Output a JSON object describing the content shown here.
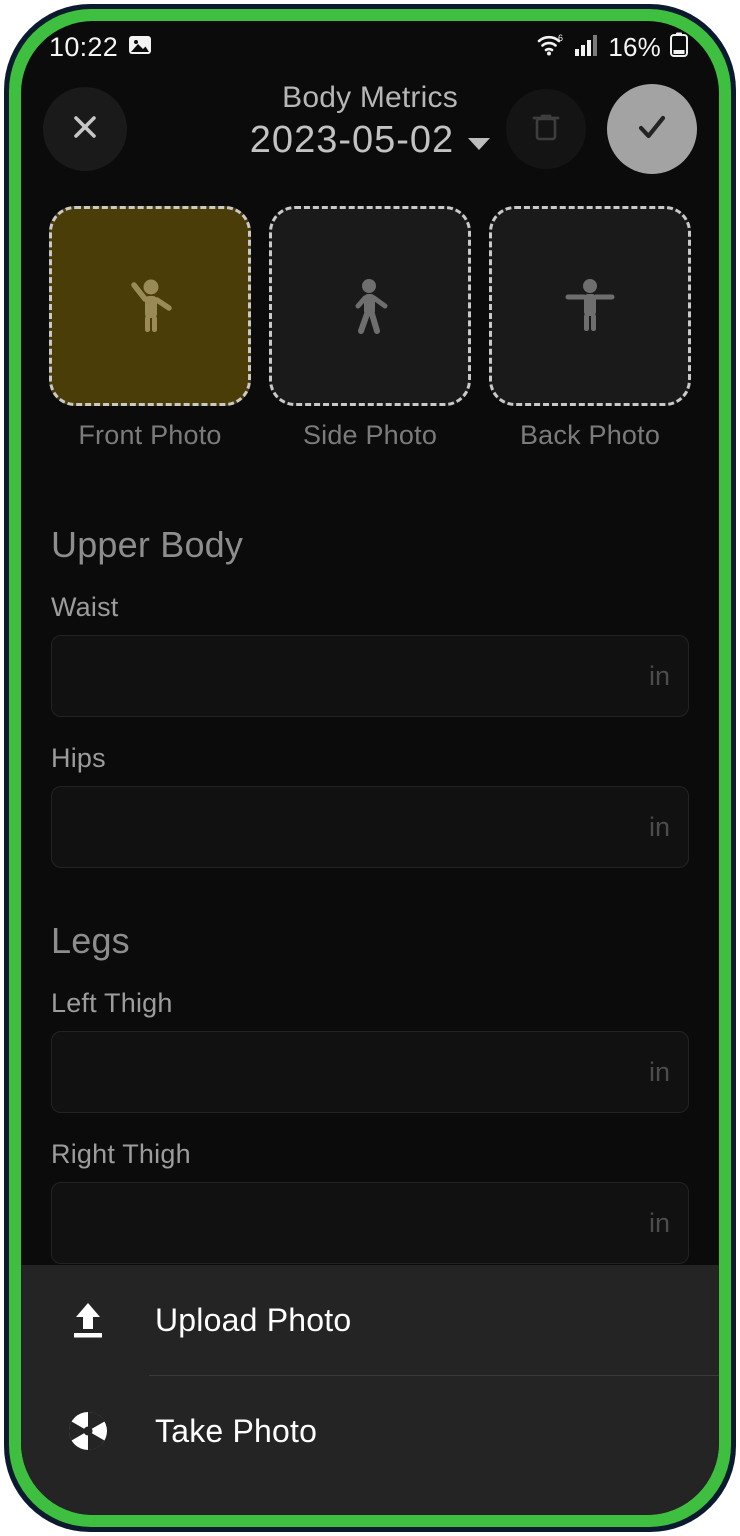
{
  "status_bar": {
    "time": "10:22",
    "notification_icon": "image-icon",
    "wifi_icon": "wifi-6-icon",
    "signal_icon": "cellular-signal-icon",
    "battery_percent": "16%",
    "battery_icon": "battery-low-icon"
  },
  "header": {
    "close_icon": "close-icon",
    "title": "Body Metrics",
    "date": "2023-05-02",
    "caret_icon": "chevron-down-icon",
    "delete_icon": "trash-icon",
    "save_icon": "check-icon"
  },
  "photos": [
    {
      "label": "Front Photo",
      "icon": "person-front-icon",
      "selected": true
    },
    {
      "label": "Side Photo",
      "icon": "person-side-icon",
      "selected": false
    },
    {
      "label": "Back Photo",
      "icon": "person-back-icon",
      "selected": false
    }
  ],
  "sections": [
    {
      "title": "Upper Body",
      "fields": [
        {
          "label": "Waist",
          "value": "",
          "unit": "in"
        },
        {
          "label": "Hips",
          "value": "",
          "unit": "in"
        }
      ]
    },
    {
      "title": "Legs",
      "fields": [
        {
          "label": "Left Thigh",
          "value": "",
          "unit": "in"
        },
        {
          "label": "Right Thigh",
          "value": "",
          "unit": "in"
        }
      ]
    }
  ],
  "bottom_sheet": {
    "upload": {
      "label": "Upload Photo",
      "icon": "upload-icon"
    },
    "take": {
      "label": "Take Photo",
      "icon": "camera-shutter-icon"
    }
  },
  "colors": {
    "screen_bg": "#0b0b0b",
    "bezel_green": "#3fbf3f",
    "frame_navy": "#0b1a2e",
    "selected_photo": "#4a3d07",
    "save_button": "#a3a3a3",
    "sheet_bg": "#242424"
  }
}
